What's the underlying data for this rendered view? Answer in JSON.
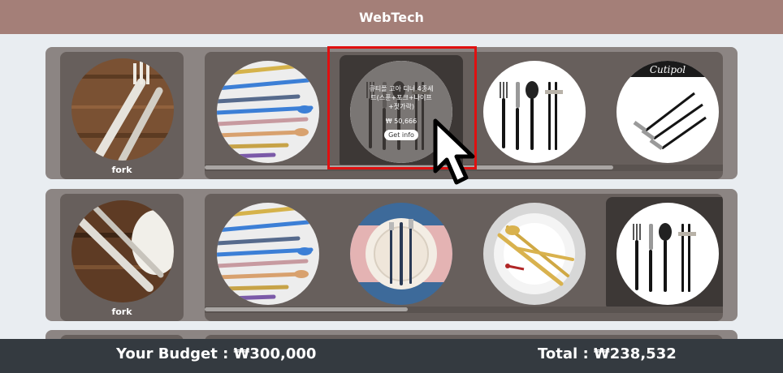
{
  "header": {
    "title": "WebTech"
  },
  "rows": [
    {
      "category_label": "fork",
      "products": [
        {
          "image": "colorful-cutlery-image"
        },
        {
          "image": "black-cutlery-image",
          "name": "큐티폴 고아 디너 4종세트(스푼+포크+나이프+젓가락)",
          "price": "₩ 50,666",
          "button_label": "Get info"
        },
        {
          "image": "black-cutlery-image"
        },
        {
          "image": "cutipol-forks-image",
          "brand_text": "Cutipol"
        }
      ]
    },
    {
      "category_label": "fork",
      "products": [
        {
          "image": "colorful-cutlery-image"
        },
        {
          "image": "plate-setting-image"
        },
        {
          "image": "gold-cutlery-plate-image"
        },
        {
          "image": "black-cutlery-image"
        }
      ]
    }
  ],
  "footer": {
    "budget_text": "Your Budget : ₩300,000",
    "total_text": "Total : ₩238,532"
  },
  "colors": {
    "header": "#a47f78",
    "row_bg": "#8c8583",
    "panel_bg": "#675f5c",
    "footer": "#343a40",
    "highlight": "#e01010"
  }
}
